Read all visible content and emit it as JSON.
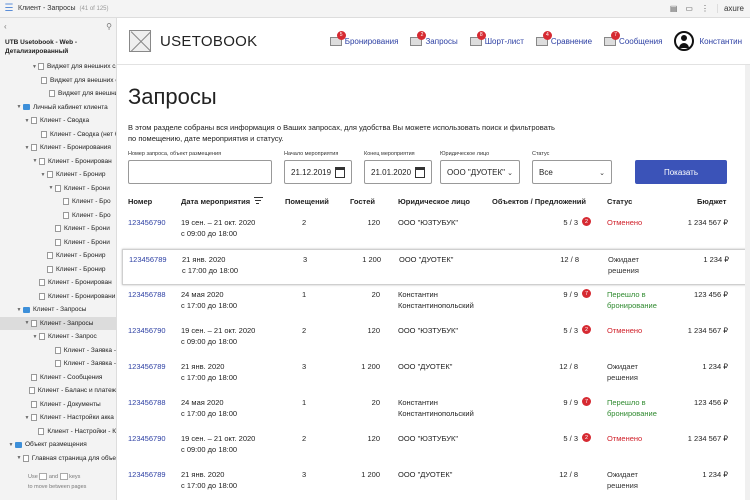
{
  "topbar": {
    "page_title": "Клиент - Запросы",
    "page_count": "(41 of 125)",
    "axure_label": "axure"
  },
  "sidebar": {
    "project_title": "UTB Usetobook - Web - Детализированный",
    "items": [
      {
        "label": "Виджет для внешних сайт",
        "indent": 2,
        "arrow": "▼",
        "type": "page"
      },
      {
        "label": "Виджет для внешних с",
        "indent": 3,
        "arrow": "",
        "type": "page"
      },
      {
        "label": "Виджет для внешних",
        "indent": 4,
        "arrow": "",
        "type": "page"
      },
      {
        "label": "Личный кабинет клиента",
        "indent": 0,
        "arrow": "▼",
        "type": "folder"
      },
      {
        "label": "Клиент - Сводка",
        "indent": 1,
        "arrow": "▼",
        "type": "page"
      },
      {
        "label": "Клиент - Сводка (нет б",
        "indent": 3,
        "arrow": "",
        "type": "page"
      },
      {
        "label": "Клиент - Бронирования",
        "indent": 1,
        "arrow": "▼",
        "type": "page"
      },
      {
        "label": "Клиент - Бронирован",
        "indent": 2,
        "arrow": "▼",
        "type": "page"
      },
      {
        "label": "Клиент - Бронир",
        "indent": 3,
        "arrow": "▼",
        "type": "page"
      },
      {
        "label": "Клиент - Брони",
        "indent": 4,
        "arrow": "▼",
        "type": "page"
      },
      {
        "label": "Клиент - Бро",
        "indent": 5,
        "arrow": "",
        "type": "page"
      },
      {
        "label": "Клиент - Бро",
        "indent": 5,
        "arrow": "",
        "type": "page"
      },
      {
        "label": "Клиент - Брони",
        "indent": 4,
        "arrow": "",
        "type": "page"
      },
      {
        "label": "Клиент - Брони",
        "indent": 4,
        "arrow": "",
        "type": "page"
      },
      {
        "label": "Клиент - Бронир",
        "indent": 3,
        "arrow": "",
        "type": "page"
      },
      {
        "label": "Клиент - Бронир",
        "indent": 3,
        "arrow": "",
        "type": "page"
      },
      {
        "label": "Клиент - Бронирован",
        "indent": 2,
        "arrow": "",
        "type": "page"
      },
      {
        "label": "Клиент - Бронировани",
        "indent": 2,
        "arrow": "",
        "type": "page"
      },
      {
        "label": "Клиент - Запросы",
        "indent": 0,
        "arrow": "▼",
        "type": "folder"
      },
      {
        "label": "Клиент - Запросы",
        "indent": 1,
        "arrow": "▼",
        "type": "page",
        "selected": true
      },
      {
        "label": "Клиент - Запрос",
        "indent": 2,
        "arrow": "▼",
        "type": "page"
      },
      {
        "label": "Клиент - Заявка -",
        "indent": 4,
        "arrow": "",
        "type": "page"
      },
      {
        "label": "Клиент - Заявка -",
        "indent": 4,
        "arrow": "",
        "type": "page"
      },
      {
        "label": "Клиент - Сообщения",
        "indent": 1,
        "arrow": "",
        "type": "page"
      },
      {
        "label": "Клиент - Баланс и платеж",
        "indent": 1,
        "arrow": "",
        "type": "page"
      },
      {
        "label": "Клиент - Документы",
        "indent": 1,
        "arrow": "",
        "type": "page"
      },
      {
        "label": "Клиент - Настройки акка",
        "indent": 1,
        "arrow": "▼",
        "type": "page"
      },
      {
        "label": "Клиент - Настройки - К",
        "indent": 2,
        "arrow": "",
        "type": "page"
      },
      {
        "label": "Объект размещения",
        "indent": -1,
        "arrow": "▼",
        "type": "folder"
      },
      {
        "label": "Главная страница для объе",
        "indent": 0,
        "arrow": "▼",
        "type": "page"
      }
    ],
    "hint_use": "Use",
    "hint_and": "and",
    "hint_keys": "keys",
    "hint_move": "to move between pages"
  },
  "header": {
    "logo_text": "USETOBOOK",
    "nav": [
      {
        "label": "Бронирования",
        "badge": "5"
      },
      {
        "label": "Запросы",
        "badge": "2"
      },
      {
        "label": "Шорт-лист",
        "badge": "8"
      },
      {
        "label": "Сравнение",
        "badge": "4"
      },
      {
        "label": "Сообщения",
        "badge": "7"
      }
    ],
    "user_name": "Константин"
  },
  "page": {
    "title": "Запросы",
    "description": "В этом разделе собраны вся информация о Ваших запросах, для удобства Вы можете использовать поиск и фильтровать по помещению, дате мероприятия и статусу."
  },
  "filters": {
    "search_label": "Номер запроса, объект размещения",
    "search_value": "",
    "start_label": "Начало мероприятия",
    "start_value": "21.12.2019",
    "end_label": "Конец мероприятия",
    "end_value": "21.01.2020",
    "entity_label": "Юридическое лицо",
    "entity_value": "ООО \"ДУОТЕК\"",
    "status_label": "Статус",
    "status_value": "Все",
    "show_button": "Показать"
  },
  "table": {
    "headers": {
      "number": "Номер",
      "date": "Дата мероприятия",
      "rooms": "Помещений",
      "guests": "Гостей",
      "entity": "Юридическое лицо",
      "objects": "Объектов / Предложений",
      "status": "Статус",
      "budget": "Бюджет"
    },
    "rows": [
      {
        "number": "123456790",
        "date1": "19 сен. – 21 окт. 2020",
        "date2": "с 09:00 до 18:00",
        "rooms": "2",
        "guests": "120",
        "entity": "ООО \"ЮЗТУБУК\"",
        "entity2": "",
        "objects": "5 / 3",
        "badge": "2",
        "status": "Отменено",
        "status2": "",
        "status_type": "red",
        "budget": "1 234 567 ₽"
      },
      {
        "number": "123456789",
        "date1": "21 янв. 2020",
        "date2": "с 17:00 до 18:00",
        "rooms": "3",
        "guests": "1 200",
        "entity": "ООО \"ДУОТЕК\"",
        "entity2": "",
        "objects": "12 / 8",
        "badge": "",
        "status": "Ожидает",
        "status2": "решения",
        "status_type": "wait",
        "budget": "1 234 ₽",
        "highlight": true
      },
      {
        "number": "123456788",
        "date1": "24 мая 2020",
        "date2": "с 17:00 до 18:00",
        "rooms": "1",
        "guests": "20",
        "entity": "Константин",
        "entity2": "Константинопольский",
        "objects": "9 / 9",
        "badge": "7",
        "status": "Перешло в",
        "status2": "бронирование",
        "status_type": "green",
        "budget": "123 456 ₽"
      },
      {
        "number": "123456790",
        "date1": "19 сен. – 21 окт. 2020",
        "date2": "с 09:00 до 18:00",
        "rooms": "2",
        "guests": "120",
        "entity": "ООО \"ЮЗТУБУК\"",
        "entity2": "",
        "objects": "5 / 3",
        "badge": "2",
        "status": "Отменено",
        "status2": "",
        "status_type": "red",
        "budget": "1 234 567 ₽"
      },
      {
        "number": "123456789",
        "date1": "21 янв. 2020",
        "date2": "с 17:00 до 18:00",
        "rooms": "3",
        "guests": "1 200",
        "entity": "ООО \"ДУОТЕК\"",
        "entity2": "",
        "objects": "12 / 8",
        "badge": "",
        "status": "Ожидает",
        "status2": "решения",
        "status_type": "wait",
        "budget": "1 234 ₽"
      },
      {
        "number": "123456788",
        "date1": "24 мая 2020",
        "date2": "с 17:00 до 18:00",
        "rooms": "1",
        "guests": "20",
        "entity": "Константин",
        "entity2": "Константинопольский",
        "objects": "9 / 9",
        "badge": "7",
        "status": "Перешло в",
        "status2": "бронирование",
        "status_type": "green",
        "budget": "123 456 ₽"
      },
      {
        "number": "123456790",
        "date1": "19 сен. – 21 окт. 2020",
        "date2": "с 09:00 до 18:00",
        "rooms": "2",
        "guests": "120",
        "entity": "ООО \"ЮЗТУБУК\"",
        "entity2": "",
        "objects": "5 / 3",
        "badge": "2",
        "status": "Отменено",
        "status2": "",
        "status_type": "red",
        "budget": "1 234 567 ₽"
      },
      {
        "number": "123456789",
        "date1": "21 янв. 2020",
        "date2": "с 17:00 до 18:00",
        "rooms": "3",
        "guests": "1 200",
        "entity": "ООО \"ДУОТЕК\"",
        "entity2": "",
        "objects": "12 / 8",
        "badge": "",
        "status": "Ожидает",
        "status2": "решения",
        "status_type": "wait",
        "budget": "1 234 ₽"
      }
    ]
  }
}
